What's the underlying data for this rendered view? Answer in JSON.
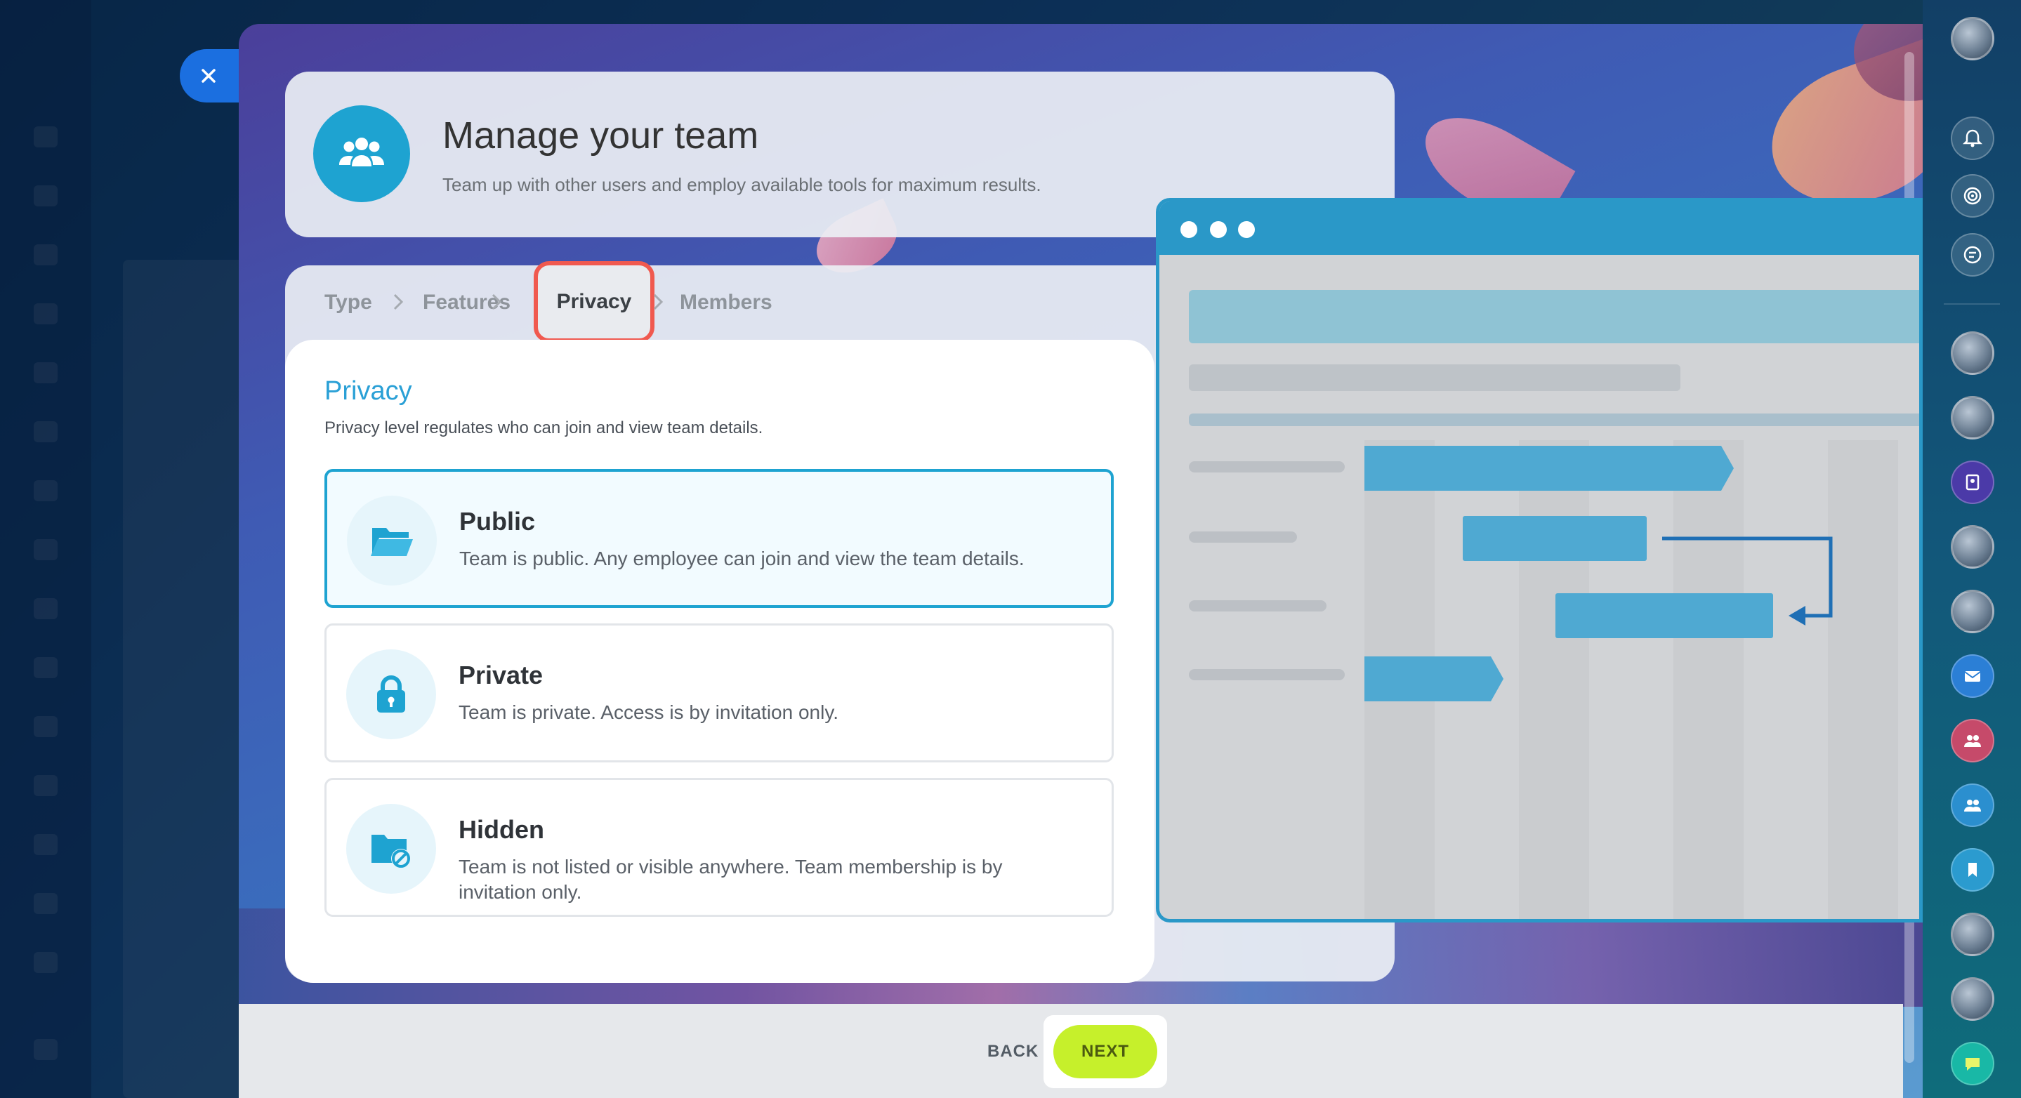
{
  "header": {
    "title": "Manage your team",
    "subtitle": "Team up with other users and employ available tools for maximum results."
  },
  "steps": {
    "items": [
      {
        "label": "Type"
      },
      {
        "label": "Features"
      },
      {
        "label": "Privacy"
      },
      {
        "label": "Members"
      }
    ],
    "active_index": 2
  },
  "privacy": {
    "title": "Privacy",
    "description": "Privacy level regulates who can join and view team details.",
    "options": [
      {
        "title": "Public",
        "description": "Team is public. Any employee can join and view the team details.",
        "icon": "open-folder-icon",
        "selected": true
      },
      {
        "title": "Private",
        "description": "Team is private. Access is by invitation only.",
        "icon": "lock-icon",
        "selected": false
      },
      {
        "title": "Hidden",
        "description": "Team is not listed or visible anywhere. Team membership is by invitation only.",
        "icon": "hidden-folder-icon",
        "selected": false
      }
    ]
  },
  "footer": {
    "back_label": "BACK",
    "next_label": "NEXT"
  },
  "colors": {
    "accent": "#1ea3d1",
    "next_button": "#c6f02b",
    "active_step_outline": "#f0594f"
  }
}
